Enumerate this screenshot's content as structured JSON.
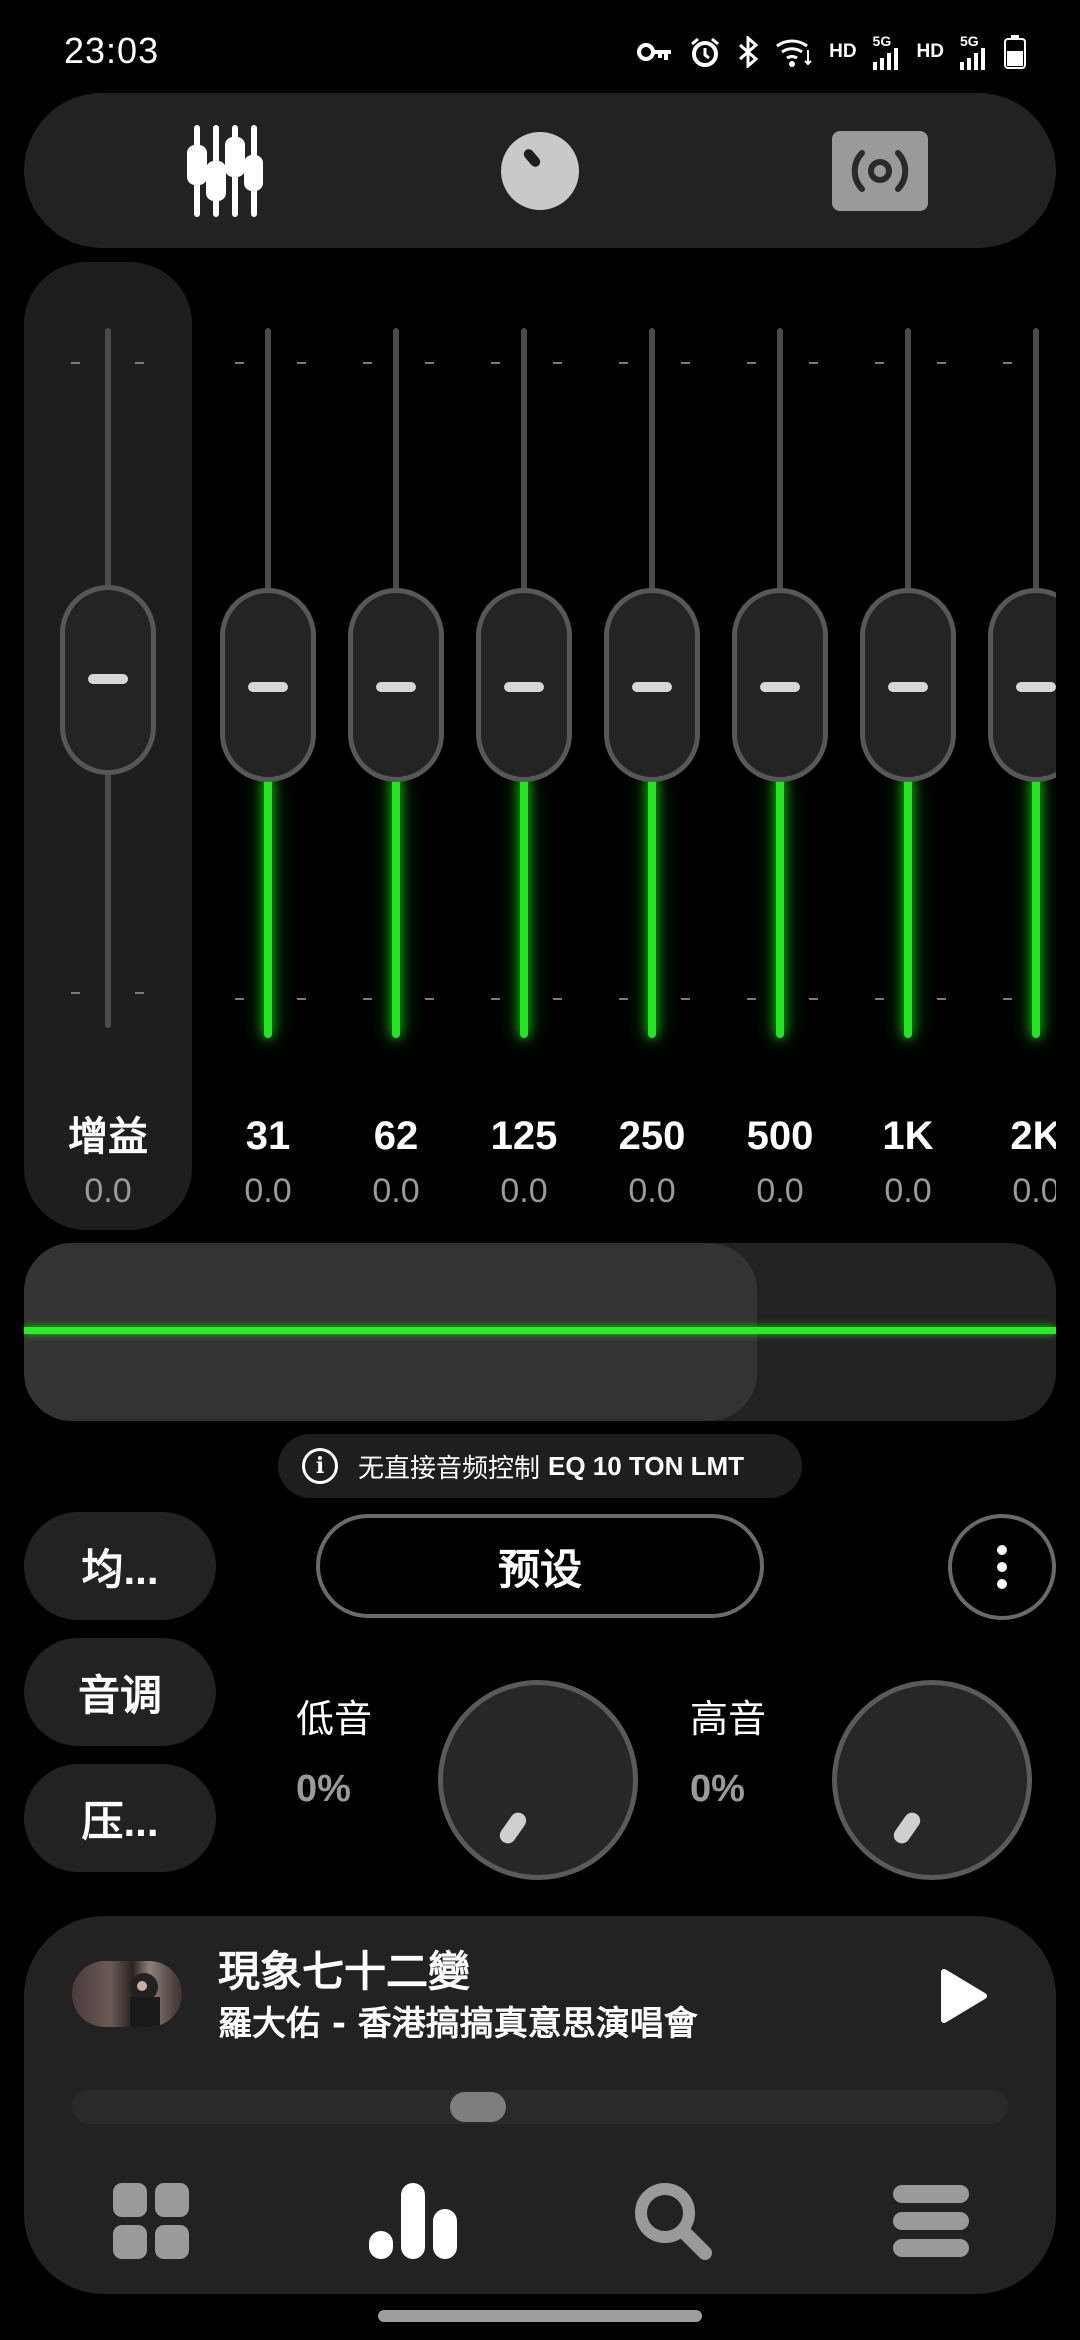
{
  "status_bar": {
    "time": "23:03",
    "indicators": [
      "key-icon",
      "alarm-icon",
      "bluetooth-icon",
      "wifi-icon"
    ],
    "hd1": "HD",
    "net1": "5G",
    "hd2": "HD",
    "net2": "5G"
  },
  "top_tabs": [
    {
      "name": "equalizer",
      "icon": "sliders-icon",
      "active": true
    },
    {
      "name": "knob",
      "icon": "knob-icon",
      "active": false
    },
    {
      "name": "speaker",
      "icon": "speaker-icon",
      "active": false
    }
  ],
  "gain": {
    "label": "增益",
    "value": "0.0"
  },
  "bands": [
    {
      "label": "31",
      "value": "0.0"
    },
    {
      "label": "62",
      "value": "0.0"
    },
    {
      "label": "125",
      "value": "0.0"
    },
    {
      "label": "250",
      "value": "0.0"
    },
    {
      "label": "500",
      "value": "0.0"
    },
    {
      "label": "1K",
      "value": "0.0"
    },
    {
      "label": "2K",
      "value": "0.0"
    }
  ],
  "visualizer": {
    "accent": "#22e622",
    "progress": 0.71
  },
  "info": {
    "prefix": "无直接音频控制",
    "device": "EQ 10 TON LMT"
  },
  "side_buttons": {
    "equalizer": "均...",
    "tone": "音调",
    "compress": "压..."
  },
  "preset_label": "预设",
  "bass": {
    "label": "低音",
    "value": "0%"
  },
  "treble": {
    "label": "高音",
    "value": "0%"
  },
  "player": {
    "title": "現象七十二變",
    "artist": "羅大佑 - 香港搞搞真意思演唱會",
    "seek_position": 0.43
  },
  "bottom_nav": [
    {
      "name": "apps",
      "icon": "grid-icon"
    },
    {
      "name": "equalizer",
      "icon": "bars-icon"
    },
    {
      "name": "search",
      "icon": "search-icon"
    },
    {
      "name": "menu",
      "icon": "menu-icon"
    }
  ]
}
